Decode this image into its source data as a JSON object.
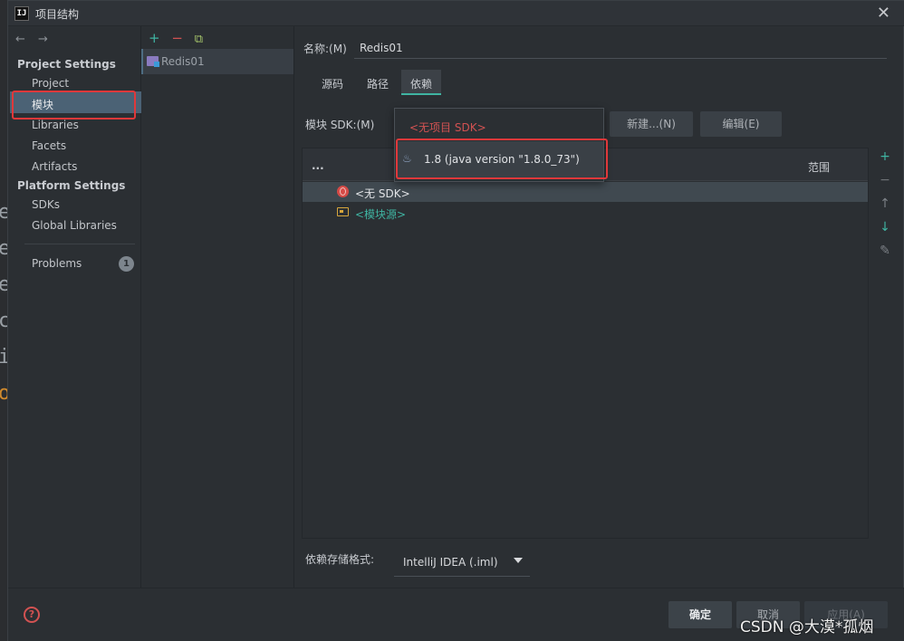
{
  "window": {
    "title": "项目结构",
    "app_icon_text": "IJ"
  },
  "leftnav": {
    "back_icon": "←",
    "forward_icon": "→",
    "project_settings_heading": "Project Settings",
    "project_items": [
      "Project",
      "模块",
      "Libraries",
      "Facets",
      "Artifacts"
    ],
    "platform_settings_heading": "Platform Settings",
    "platform_items": [
      "SDKs",
      "Global Libraries"
    ],
    "problems_label": "Problems",
    "problems_count": "1",
    "selected_item": "模块"
  },
  "modules": {
    "toolbar": {
      "add": "+",
      "remove": "−",
      "copy": "⧉"
    },
    "items": [
      "Redis01"
    ]
  },
  "main": {
    "name_label": "名称:(M)",
    "name_value": "Redis01",
    "tabs": [
      "源码",
      "路径",
      "依赖"
    ],
    "active_tab": "依赖",
    "sdk_label": "模块 SDK:(M)",
    "new_button": "新建...(N)",
    "edit_button": "编辑(E)",
    "table_header_left": "...",
    "table_header_scope": "范围",
    "dependencies": [
      {
        "icon": "globe-icon",
        "text": "<无 SDK>",
        "selected": true
      },
      {
        "icon": "folder-icon",
        "text": "<模块源>",
        "selected": false
      }
    ],
    "side_tools": {
      "add": "+",
      "remove": "−",
      "up": "↑",
      "down": "↓",
      "edit": "✎"
    },
    "format_label": "依赖存储格式:",
    "format_value": "IntelliJ IDEA (.iml)"
  },
  "sdk_dropdown": {
    "options": [
      "<无项目 SDK>",
      "1.8 (java version \"1.8.0_73\")"
    ],
    "highlighted": "1.8 (java version \"1.8.0_73\")"
  },
  "footer": {
    "help": "?",
    "ok": "确定",
    "cancel": "取消",
    "apply": "应用(A)"
  },
  "watermark": "CSDN @大漠*孤烟",
  "colors": {
    "accent": "#3fb4a2",
    "selection": "#4b6275",
    "annotation_red": "#e0383a",
    "error_red": "#d25252"
  }
}
